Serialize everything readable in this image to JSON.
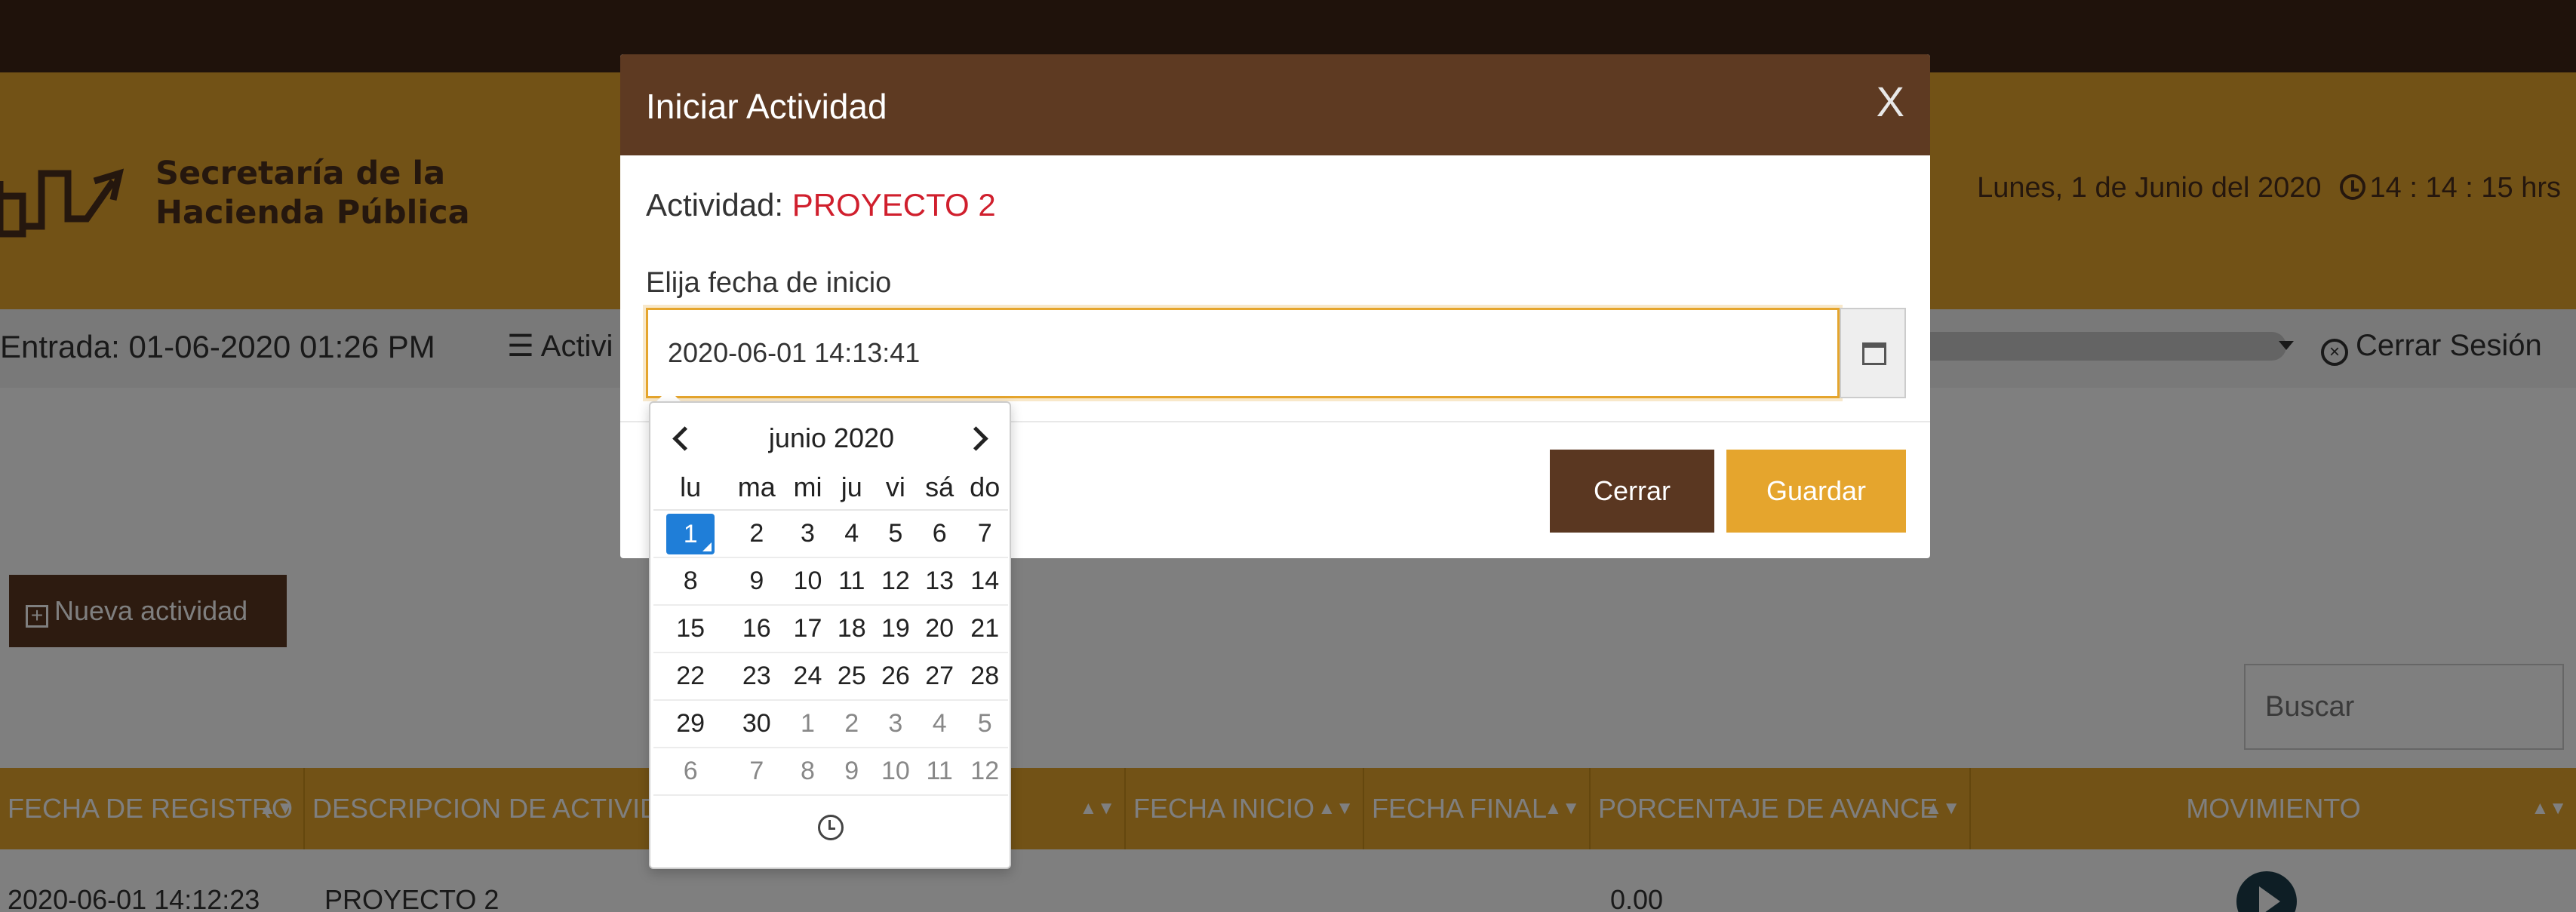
{
  "header": {
    "org_name_line1": "Secretaría de la",
    "org_name_line2": "Hacienda Pública",
    "date_text": "Lunes, 1 de Junio del 2020",
    "time_text": "14 : 14 : 15 hrs"
  },
  "nav": {
    "entrada": "Entrada: 01-06-2020 01:26 PM",
    "actividades_partial": "Activi",
    "logout": "Cerrar Sesión"
  },
  "toolbar": {
    "nueva_actividad": "Nueva actividad",
    "search_placeholder": "Buscar"
  },
  "table": {
    "columns": [
      "FECHA DE REGISTRO",
      "DESCRIPCION DE ACTIVIDA",
      "",
      "FECHA INICIO",
      "FECHA FINAL",
      "PORCENTAJE DE AVANCE",
      "MOVIMIENTO"
    ],
    "rows": [
      {
        "fecha_registro": "2020-06-01 14:12:23",
        "descripcion": "PROYECTO 2",
        "porcentaje": "0.00"
      }
    ]
  },
  "modal": {
    "title": "Iniciar Actividad",
    "close_label": "X",
    "actividad_label": "Actividad:",
    "actividad_value": "PROYECTO 2",
    "fecha_label": "Elija fecha de inicio",
    "fecha_value": "2020-06-01 14:13:41",
    "cerrar_label": "Cerrar",
    "guardar_label": "Guardar"
  },
  "datepicker": {
    "title": "junio 2020",
    "weekdays": [
      "lu",
      "ma",
      "mi",
      "ju",
      "vi",
      "sá",
      "do"
    ],
    "weeks": [
      [
        "1",
        "2",
        "3",
        "4",
        "5",
        "6",
        "7"
      ],
      [
        "8",
        "9",
        "10",
        "11",
        "12",
        "13",
        "14"
      ],
      [
        "15",
        "16",
        "17",
        "18",
        "19",
        "20",
        "21"
      ],
      [
        "22",
        "23",
        "24",
        "25",
        "26",
        "27",
        "28"
      ],
      [
        "29",
        "30",
        "1",
        "2",
        "3",
        "4",
        "5"
      ],
      [
        "6",
        "7",
        "8",
        "9",
        "10",
        "11",
        "12"
      ]
    ],
    "selected_day": "1"
  },
  "colors": {
    "brand_gold": "#e5a52d",
    "brand_brown": "#5e3a22",
    "top_bar": "#3f2516",
    "highlight_red": "#d01f2d",
    "selected_blue": "#1f7ed8"
  }
}
